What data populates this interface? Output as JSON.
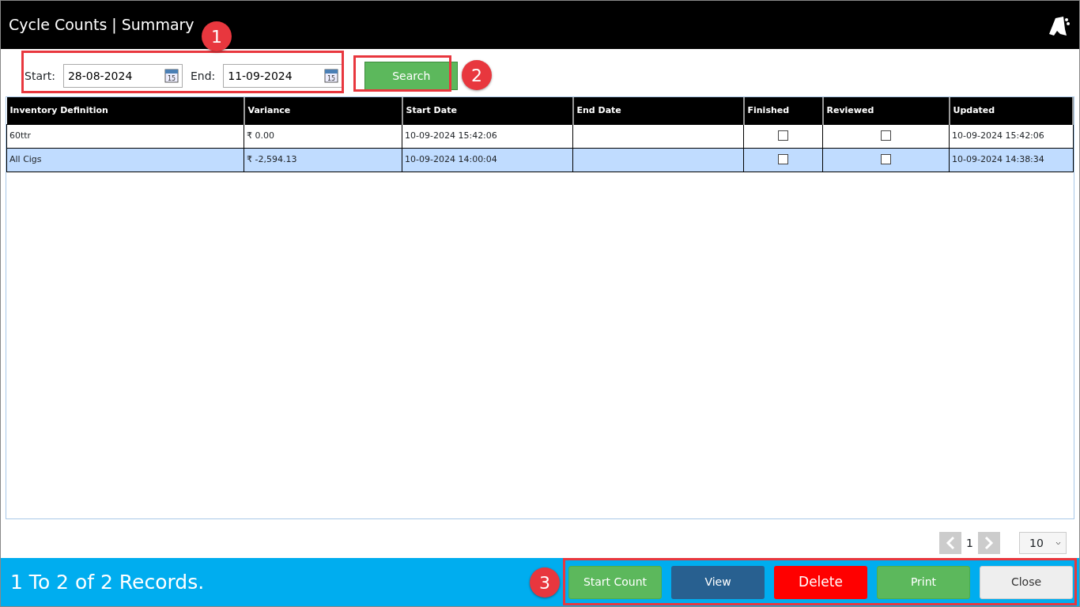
{
  "window": {
    "title": "Cycle Counts | Summary"
  },
  "filter": {
    "start_label": "Start:",
    "start_value": "28-08-2024",
    "end_label": "End:",
    "end_value": "11-09-2024",
    "search_button": "Search",
    "start_calendar_day": "15",
    "end_calendar_day": "15"
  },
  "table": {
    "columns": [
      "Inventory Definition",
      "Variance",
      "Start Date",
      "End Date",
      "Finished",
      "Reviewed",
      "Updated"
    ],
    "rows": [
      {
        "inventory_definition": "60ttr",
        "variance": "₹ 0.00",
        "start_date": "10-09-2024 15:42:06",
        "end_date": "",
        "finished": false,
        "reviewed": false,
        "updated": "10-09-2024 15:42:06",
        "selected": false
      },
      {
        "inventory_definition": "All Cigs",
        "variance": "₹ -2,594.13",
        "start_date": "10-09-2024 14:00:04",
        "end_date": "",
        "finished": false,
        "reviewed": false,
        "updated": "10-09-2024 14:38:34",
        "selected": true
      }
    ]
  },
  "pagination": {
    "page": "1",
    "page_size": "10"
  },
  "status_bar": {
    "text": "1 To 2 of 2 Records."
  },
  "buttons": [
    {
      "label": "Start Count",
      "kind": "success"
    },
    {
      "label": "View",
      "kind": "primary"
    },
    {
      "label": "Delete",
      "kind": "danger"
    },
    {
      "label": "Print",
      "kind": "success"
    },
    {
      "label": "Close",
      "kind": "light"
    }
  ],
  "callouts": [
    "1",
    "2",
    "3"
  ]
}
